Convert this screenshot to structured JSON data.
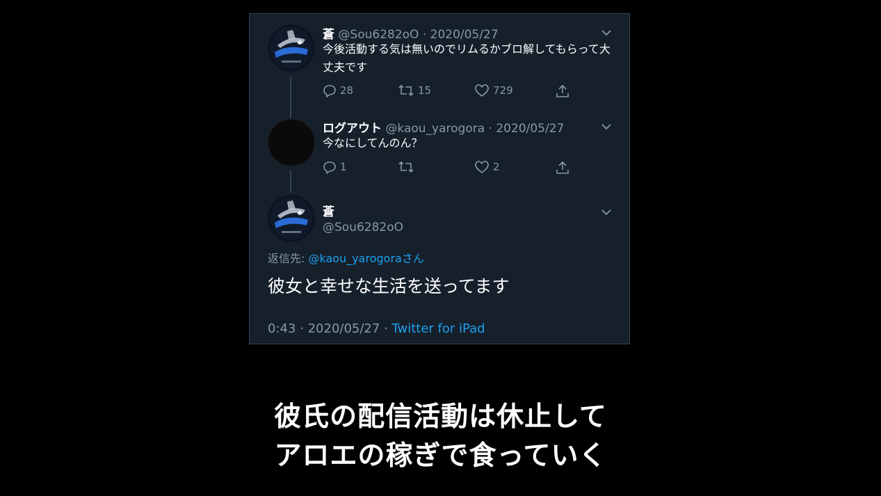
{
  "tweets": [
    {
      "name": "蒼",
      "meta": "@Sou6282oO · 2020/05/27",
      "text": "今後活動する気は無いのでリムるかブロ解してもらって大丈夫です",
      "reply_count": "28",
      "retweet_count": "15",
      "like_count": "729"
    },
    {
      "name": "ログアウト",
      "meta": "@kaou_yarogora · 2020/05/27",
      "text": "今なにしてんのん？",
      "reply_count": "1",
      "retweet_count": "",
      "like_count": "2"
    }
  ],
  "detail": {
    "name": "蒼",
    "handle": "@Sou6282oO",
    "reply_prefix": "返信先: ",
    "reply_mention": "@kaou_yarogora",
    "reply_suffix": "さん",
    "text": "彼女と幸せな生活を送ってます",
    "time_date": "0:43 · 2020/05/27 · ",
    "client": "Twitter for iPad"
  },
  "caption": {
    "line1": "彼氏の配信活動は休止して",
    "line2": "アロエの稼ぎで食っていく"
  },
  "colors": {
    "panel_bg": "#15202b",
    "secondary_text": "#8899a6",
    "link": "#1da1f2",
    "thread_line": "#38444d"
  },
  "icons": [
    "reply-icon",
    "retweet-icon",
    "like-icon",
    "share-icon",
    "chevron-down-icon"
  ]
}
